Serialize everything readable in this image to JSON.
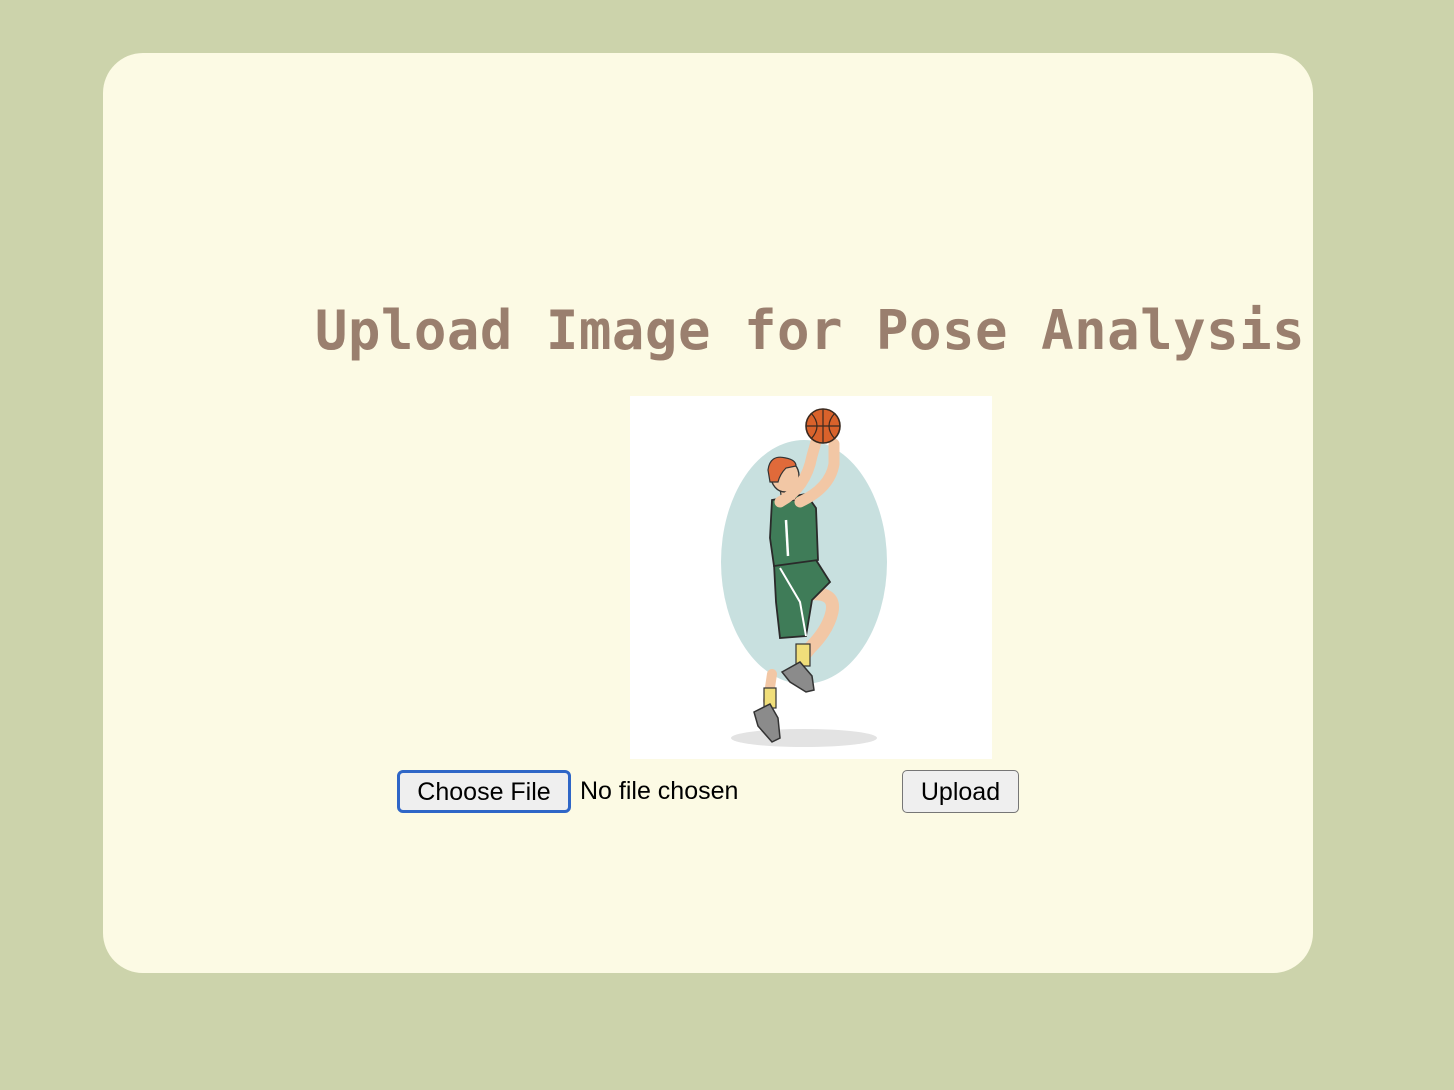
{
  "page": {
    "title": "Upload Image for Pose Analysis"
  },
  "preview": {
    "subject": "basketball-player-illustration"
  },
  "upload_form": {
    "choose_file_label": "Choose File",
    "file_status": "No file chosen",
    "upload_label": "Upload"
  },
  "colors": {
    "background": "#ccd3ab",
    "card": "#fcfae4",
    "title": "#9a7f6e",
    "focus_ring": "#2f66c7"
  }
}
